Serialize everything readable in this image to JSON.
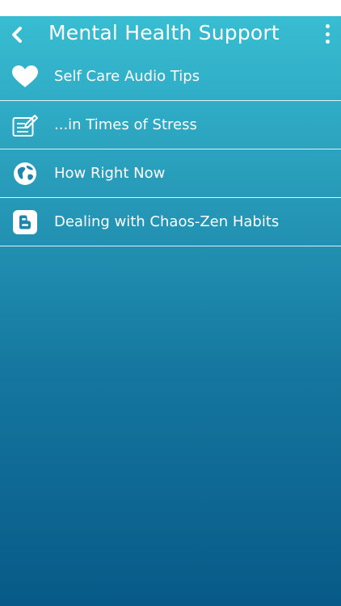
{
  "header": {
    "title": "Mental Health Support",
    "back_icon": "chevron-left-icon",
    "more_icon": "more-vertical-icon"
  },
  "menu": {
    "items": [
      {
        "label": "Self Care Audio Tips",
        "icon": "heart-icon"
      },
      {
        "label": "...in Times of Stress",
        "icon": "notepad-pen-icon"
      },
      {
        "label": "How Right Now",
        "icon": "globe-icon"
      },
      {
        "label": "Dealing with Chaos-Zen Habits",
        "icon": "blogger-icon"
      }
    ]
  },
  "colors": {
    "gradient_top": "#38bdd2",
    "gradient_bottom": "#075a87",
    "text": "#ffffff"
  }
}
